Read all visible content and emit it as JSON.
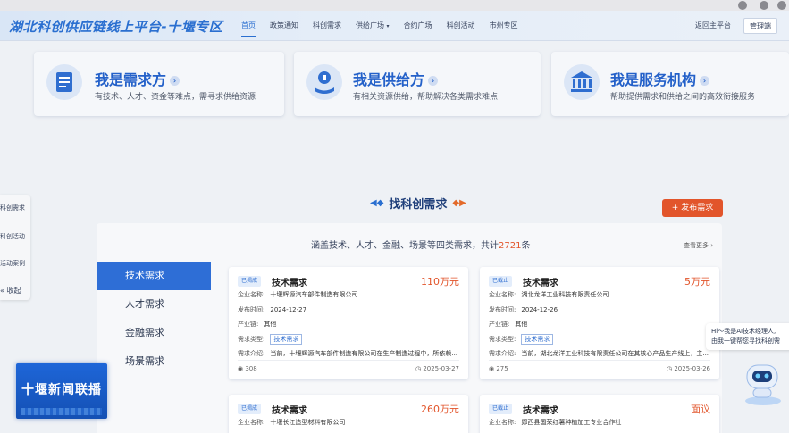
{
  "header": {
    "logo": "湖北科创供应链线上平台-十堰专区",
    "nav": [
      "首页",
      "政策通知",
      "科创需求",
      "供给广场",
      "合约广场",
      "科创活动",
      "市州专区"
    ],
    "nav_dropdown_index": 3,
    "back_label": "返回主平台",
    "admin_label": "管理端"
  },
  "roles": [
    {
      "title": "我是需求方",
      "desc": "有技术、人才、资金等难点，需寻求供给资源",
      "icon": "document-icon"
    },
    {
      "title": "我是供给方",
      "desc": "有相关资源供给，帮助解决各类需求难点",
      "icon": "hand-supply-icon"
    },
    {
      "title": "我是服务机构",
      "desc": "帮助提供需求和供给之间的高效衔接服务",
      "icon": "institution-icon"
    }
  ],
  "float_sidebar": {
    "items": [
      "科创需求",
      "科创活动",
      "活动案例"
    ],
    "collapse": "收起"
  },
  "section": {
    "title": "找科创需求",
    "publish": "发布需求",
    "summary_prefix": "涵盖技术、人才、金融、场景等四类需求，共计",
    "summary_count": "2721",
    "summary_suffix": "条",
    "view_more": "查看更多"
  },
  "tabs": [
    "技术需求",
    "人才需求",
    "金融需求",
    "场景需求"
  ],
  "cards": [
    {
      "status": "已揭成",
      "title": "技术需求",
      "price": "110万元",
      "company_label": "企业名称:",
      "company": "十堰辉源汽车部件制造有限公司",
      "date_label": "发布时间:",
      "date": "2024-12-27",
      "industry_label": "产业链:",
      "industry": "其他",
      "type_label": "需求类型:",
      "type": "技术需求",
      "intro_label": "需求介绍:",
      "intro": "当前，十堰辉源汽车部件制造有限公司在生产制造过程中，所依赖...",
      "views": "308",
      "deadline": "2025-03-27"
    },
    {
      "status": "已截止",
      "title": "技术需求",
      "price": "5万元",
      "company_label": "企业名称:",
      "company": "湖北龙洋工业科技有限责任公司",
      "date_label": "发布时间:",
      "date": "2024-12-26",
      "industry_label": "产业链:",
      "industry": "其他",
      "type_label": "需求类型:",
      "type": "技术需求",
      "intro_label": "需求介绍:",
      "intro": "当前，湖北龙洋工业科技有限责任公司在其核心产品生产线上，主...",
      "views": "275",
      "deadline": "2025-03-26"
    },
    {
      "status": "已揭成",
      "title": "技术需求",
      "price": "260万元",
      "company_label": "企业名称:",
      "company": "十堰长江造型材料有限公司"
    },
    {
      "status": "已截止",
      "title": "技术需求",
      "price": "面议",
      "company_label": "企业名称:",
      "company": "郧西县国荣红薯种植加工专业合作社"
    }
  ],
  "chat": {
    "line1": "Hi～我是AI技术经理人,",
    "line2": "由我一键帮您寻找科创需"
  },
  "tv_logo": "十堰新闻联播",
  "colors": {
    "brand_blue": "#2a6fd0",
    "accent_orange": "#e2552b",
    "tab_active": "#2e6ed6"
  }
}
